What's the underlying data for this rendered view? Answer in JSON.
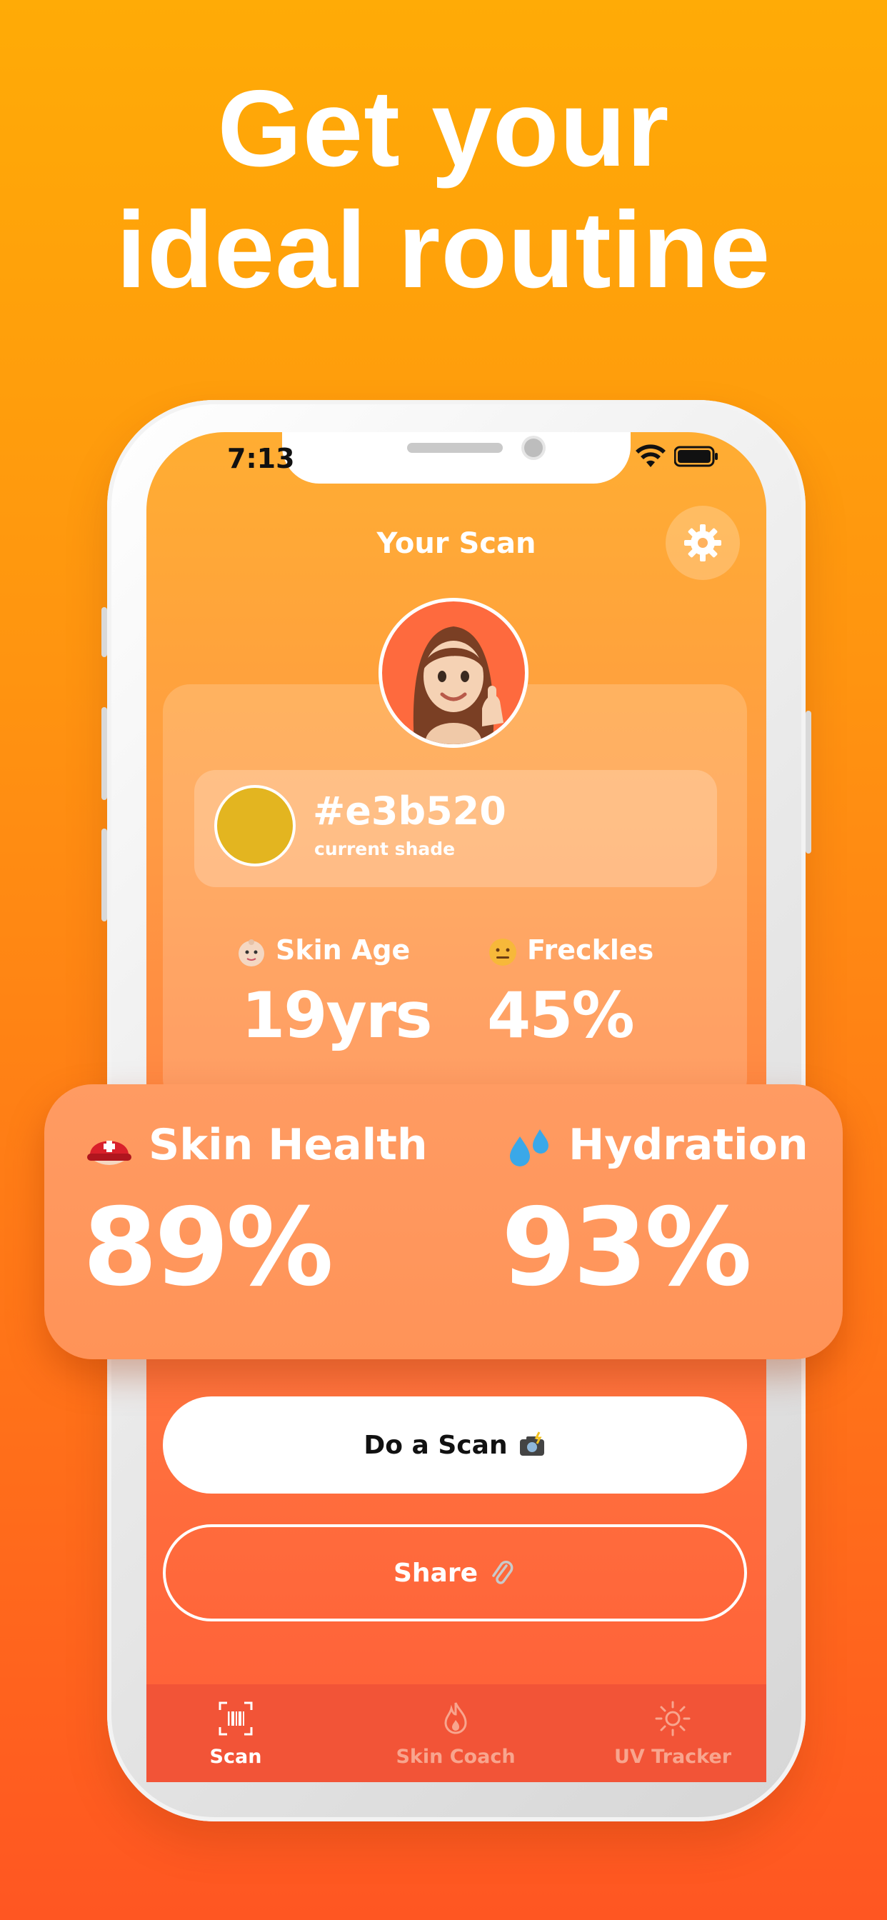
{
  "headline": {
    "line1": "Get your",
    "line2": "ideal routine"
  },
  "status_bar": {
    "time": "7:13"
  },
  "screen": {
    "title": "Your Scan"
  },
  "shade": {
    "hex": "#e3b520",
    "label": "current shade",
    "swatch_color": "#e3b520"
  },
  "stats": [
    {
      "emoji": "baby-face-icon",
      "label": "Skin Age",
      "value": "19yrs"
    },
    {
      "emoji": "neutral-face-icon",
      "label": "Freckles",
      "value": "45%"
    }
  ],
  "highlight": [
    {
      "emoji": "rescue-helmet-icon",
      "label": "Skin Health",
      "value": "89%"
    },
    {
      "emoji": "sweat-droplets-icon",
      "label": "Hydration",
      "value": "93%"
    }
  ],
  "buttons": {
    "scan": "Do a Scan",
    "share": "Share"
  },
  "tabs": [
    {
      "label": "Scan",
      "icon": "barcode-scan-icon",
      "active": true
    },
    {
      "label": "Skin Coach",
      "icon": "flame-icon",
      "active": false
    },
    {
      "label": "UV Tracker",
      "icon": "sun-icon",
      "active": false
    }
  ],
  "colors": {
    "accent": "#ff8a2a",
    "shade": "#e3b520",
    "tab_active": "#ffffff",
    "tab_inactive": "#f8a58e"
  }
}
